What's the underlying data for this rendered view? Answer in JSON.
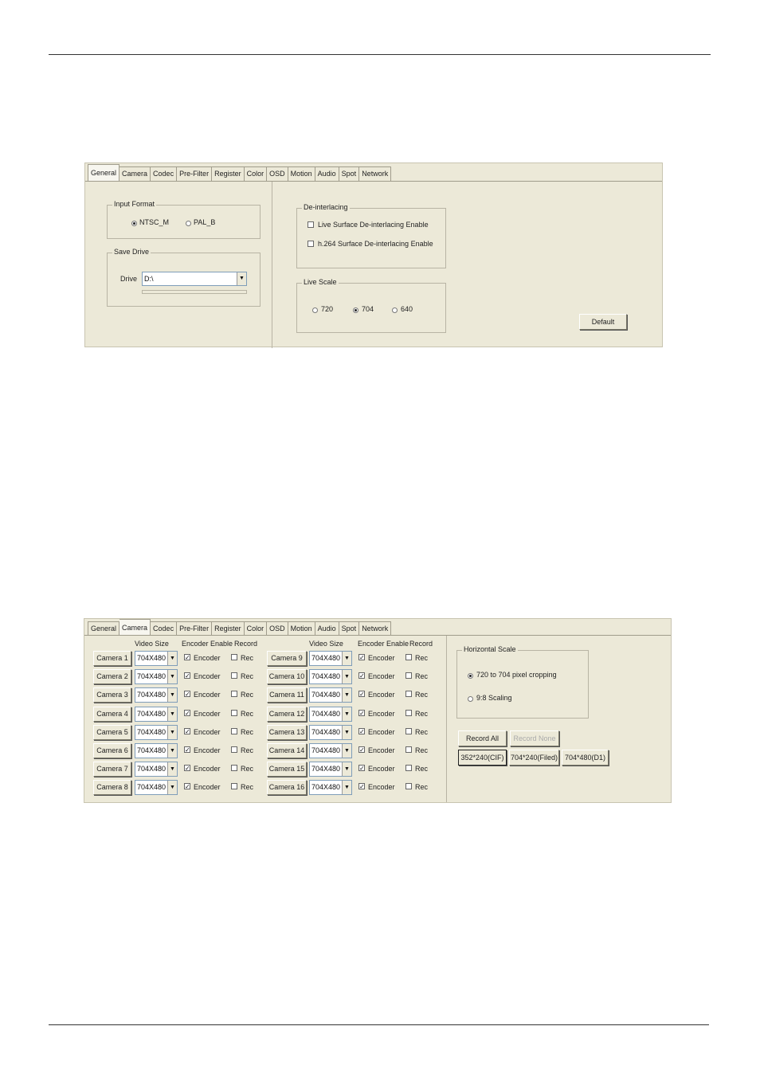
{
  "panel1": {
    "tabs": [
      "General",
      "Camera",
      "Codec",
      "Pre-Filter",
      "Register",
      "Color",
      "OSD",
      "Motion",
      "Audio",
      "Spot",
      "Network"
    ],
    "active_tab": "General",
    "input_format": {
      "legend": "Input Format",
      "options": [
        "NTSC_M",
        "PAL_B"
      ],
      "selected": "NTSC_M"
    },
    "save_drive": {
      "legend": "Save Drive",
      "drive_label": "Drive",
      "drive_value": "D:\\"
    },
    "deinterlacing": {
      "legend": "De-interlacing",
      "live_label": "Live Surface De-interlacing Enable",
      "h264_label": "h.264 Surface De-interlacing Enable"
    },
    "live_scale": {
      "legend": "Live Scale",
      "options": [
        "720",
        "704",
        "640"
      ],
      "selected": "704"
    },
    "default_label": "Default"
  },
  "panel2": {
    "tabs": [
      "General",
      "Camera",
      "Codec",
      "Pre-Filter",
      "Register",
      "Color",
      "OSD",
      "Motion",
      "Audio",
      "Spot",
      "Network"
    ],
    "active_tab": "Camera",
    "headers": {
      "video_size": "Video Size",
      "encoder_enable": "Encoder Enable",
      "record": "Record"
    },
    "cameras_left": [
      {
        "name": "Camera 1",
        "size": "704X480",
        "encoder": "Encoder",
        "rec": "Rec"
      },
      {
        "name": "Camera 2",
        "size": "704X480",
        "encoder": "Encoder",
        "rec": "Rec"
      },
      {
        "name": "Camera 3",
        "size": "704X480",
        "encoder": "Encoder",
        "rec": "Rec"
      },
      {
        "name": "Camera 4",
        "size": "704X480",
        "encoder": "Encoder",
        "rec": "Rec"
      },
      {
        "name": "Camera 5",
        "size": "704X480",
        "encoder": "Encoder",
        "rec": "Rec"
      },
      {
        "name": "Camera 6",
        "size": "704X480",
        "encoder": "Encoder",
        "rec": "Rec"
      },
      {
        "name": "Camera 7",
        "size": "704X480",
        "encoder": "Encoder",
        "rec": "Rec"
      },
      {
        "name": "Camera 8",
        "size": "704X480",
        "encoder": "Encoder",
        "rec": "Rec"
      }
    ],
    "cameras_right": [
      {
        "name": "Camera 9",
        "size": "704X480",
        "encoder": "Encoder",
        "rec": "Rec"
      },
      {
        "name": "Camera 10",
        "size": "704X480",
        "encoder": "Encoder",
        "rec": "Rec"
      },
      {
        "name": "Camera 11",
        "size": "704X480",
        "encoder": "Encoder",
        "rec": "Rec"
      },
      {
        "name": "Camera 12",
        "size": "704X480",
        "encoder": "Encoder",
        "rec": "Rec"
      },
      {
        "name": "Camera 13",
        "size": "704X480",
        "encoder": "Encoder",
        "rec": "Rec"
      },
      {
        "name": "Camera 14",
        "size": "704X480",
        "encoder": "Encoder",
        "rec": "Rec"
      },
      {
        "name": "Camera 15",
        "size": "704X480",
        "encoder": "Encoder",
        "rec": "Rec"
      },
      {
        "name": "Camera 16",
        "size": "704X480",
        "encoder": "Encoder",
        "rec": "Rec"
      }
    ],
    "horizontal_scale": {
      "legend": "Horizontal Scale",
      "options": [
        "720 to 704 pixel cropping",
        "9:8 Scaling"
      ],
      "selected": "720 to 704 pixel cropping"
    },
    "record_all_label": "Record All",
    "record_none_label": "Record None",
    "resolutions": [
      "352*240(CIF)",
      "704*240(Filed)",
      "704*480(D1)"
    ],
    "selected_resolution": "352*240(CIF)"
  }
}
